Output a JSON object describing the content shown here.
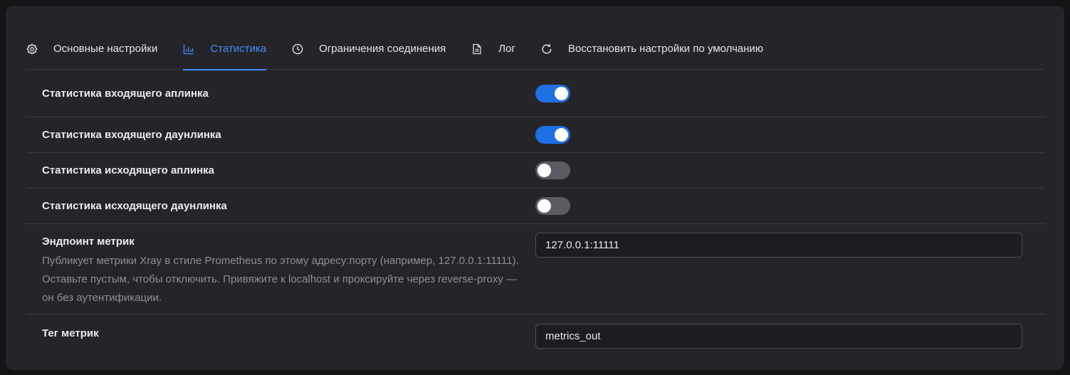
{
  "tabs": [
    {
      "label": "Основные настройки",
      "icon": "gear-icon",
      "active": false
    },
    {
      "label": "Статистика",
      "icon": "bar-chart-icon",
      "active": true
    },
    {
      "label": "Ограничения соединения",
      "icon": "clock-icon",
      "active": false
    },
    {
      "label": "Лог",
      "icon": "document-icon",
      "active": false
    },
    {
      "label": "Восстановить настройки по умолчанию",
      "icon": "refresh-icon",
      "active": false
    }
  ],
  "settings": {
    "inbound_uplink": {
      "label": "Статистика входящего аплинка",
      "enabled": true
    },
    "inbound_downlink": {
      "label": "Статистика входящего даунлинка",
      "enabled": true
    },
    "outbound_uplink": {
      "label": "Статистика исходящего аплинка",
      "enabled": false
    },
    "outbound_downlink": {
      "label": "Статистика исходящего даунлинка",
      "enabled": false
    },
    "metrics_endpoint": {
      "label": "Эндпоинт метрик",
      "description": "Публикует метрики Xray в стиле Prometheus по этому адресу:порту (например, 127.0.0.1:11111). Оставьте пустым, чтобы отключить. Привяжите к localhost и проксируйте через reverse-proxy — он без аутентификации.",
      "value": "127.0.0.1:11111"
    },
    "metrics_tag": {
      "label": "Тег метрик",
      "value": "metrics_out"
    }
  },
  "colors": {
    "accent": "#3f8cff",
    "toggle_on": "#1f6fe5",
    "toggle_off": "#5b5b61",
    "card": "#252529"
  }
}
